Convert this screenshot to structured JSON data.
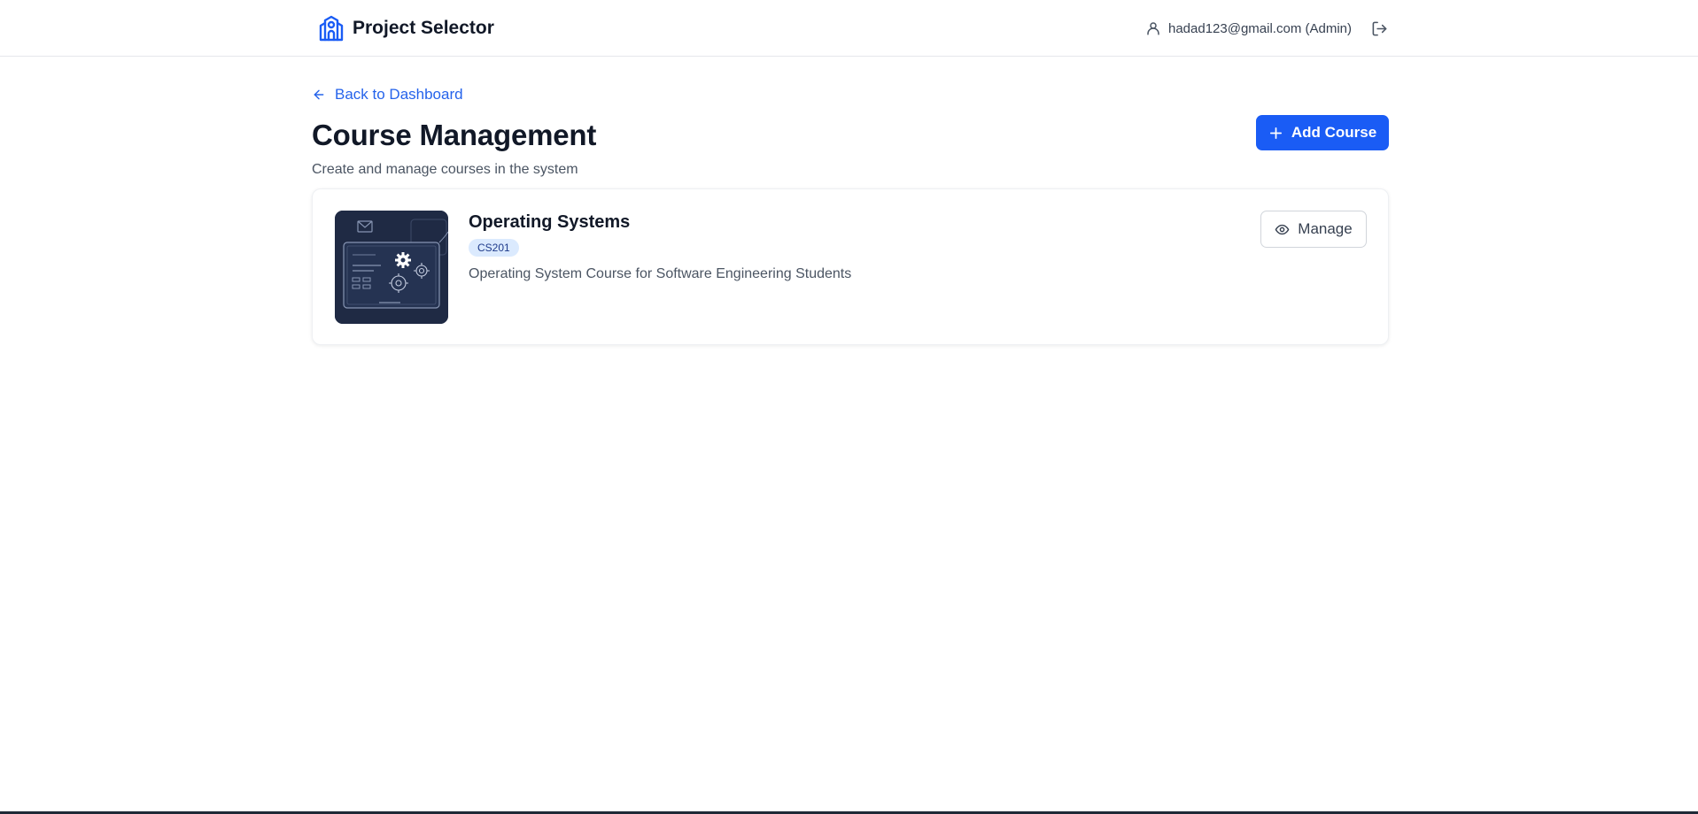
{
  "header": {
    "title": "Project Selector",
    "user_label": "hadad123@gmail.com (Admin)"
  },
  "nav": {
    "back_label": "Back to Dashboard"
  },
  "page": {
    "title": "Course Management",
    "subtitle": "Create and manage courses in the system",
    "add_button_label": "Add Course"
  },
  "courses": [
    {
      "name": "Operating Systems",
      "code": "CS201",
      "description": "Operating System Course for Software Engineering Students",
      "manage_label": "Manage"
    }
  ],
  "icons": {
    "brand": "school-building-icon",
    "user": "user-icon",
    "logout": "logout-icon",
    "back": "arrow-left-icon",
    "add": "plus-icon",
    "manage": "eye-icon"
  },
  "colors": {
    "primary": "#1a5cf5",
    "link": "#2563eb",
    "badge_bg": "#dbeafe",
    "thumbnail_bg": "#1f2a44"
  }
}
